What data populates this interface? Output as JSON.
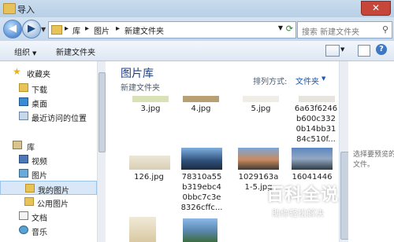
{
  "window": {
    "title": "导入"
  },
  "navbar": {
    "breadcrumbs": [
      "库",
      "图片",
      "新建文件夹"
    ],
    "search_placeholder": "搜索 新建文件夹"
  },
  "toolbar": {
    "organize": "组织",
    "new_folder": "新建文件夹"
  },
  "sidebar": {
    "favorites": "收藏夹",
    "downloads": "下载",
    "desktop": "桌面",
    "recent": "最近访问的位置",
    "libraries": "库",
    "videos": "视频",
    "pictures": "图片",
    "my_pictures": "我的图片",
    "public_pictures": "公用图片",
    "documents": "文档",
    "music": "音乐"
  },
  "main": {
    "library_title": "图片库",
    "subtitle": "新建文件夹",
    "arrange_label": "排列方式:",
    "arrange_value": "文件夹",
    "files": [
      {
        "lines": [
          "3.jpg"
        ]
      },
      {
        "lines": [
          "4.jpg"
        ]
      },
      {
        "lines": [
          "5.jpg"
        ]
      },
      {
        "lines": [
          "6a63f6246",
          "b600c332",
          "0b14bb31",
          "84c510f..."
        ]
      },
      {
        "lines": [
          "126.jpg"
        ]
      },
      {
        "lines": [
          "78310a55",
          "b319ebc4",
          "0bbc7c3e",
          "8326cffc..."
        ]
      },
      {
        "lines": [
          "1029163a",
          "1-5.jpg"
        ]
      },
      {
        "lines": [
          "16041446"
        ]
      }
    ]
  },
  "preview": {
    "text": "选择要预览的文件。"
  },
  "watermark": {
    "main": "百科全说",
    "sub": "助你轻松解决"
  }
}
